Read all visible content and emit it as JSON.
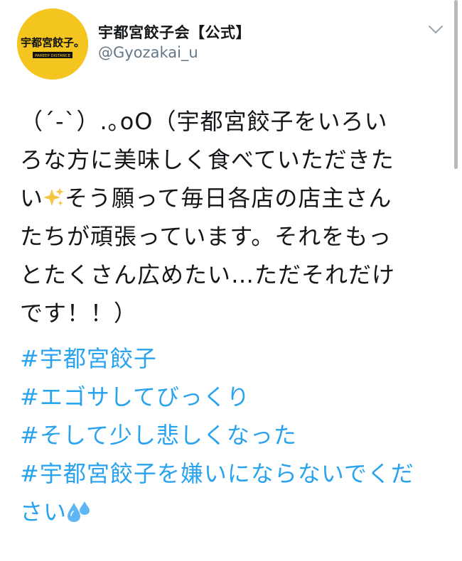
{
  "author": {
    "display_name": "宇都宮餃子会【公式】",
    "handle": "@Gyozakai_u",
    "avatar_text": "宇都宮餃子。",
    "avatar_subtext": "PAREEP DISTANCE"
  },
  "tweet": {
    "lines": [
      "（´-`）.｡oO（宇都宮餃子をいろい",
      "ろな方に美味しく食べていただきた",
      "い",
      "そう願って毎日各店の店主さん",
      "たちが頑張っています。それをもっ",
      "とたくさん広めたい…ただそれだけ",
      "です！！）"
    ],
    "hashtags": [
      "#宇都宮餃子",
      "#エゴサしてびっくり",
      "#そして少し悲しくなった",
      "#宇都宮餃子を嫌いにならないでくだ"
    ],
    "hashtag_last_line": "さい",
    "emoji": [
      "sparkles-emoji",
      "sweat-droplets-emoji"
    ],
    "colors": {
      "hashtag": "#2aa3ef",
      "avatar": "#f4c41f",
      "handle": "#657786"
    }
  },
  "icons": {
    "menu": "chevron-down-icon"
  }
}
